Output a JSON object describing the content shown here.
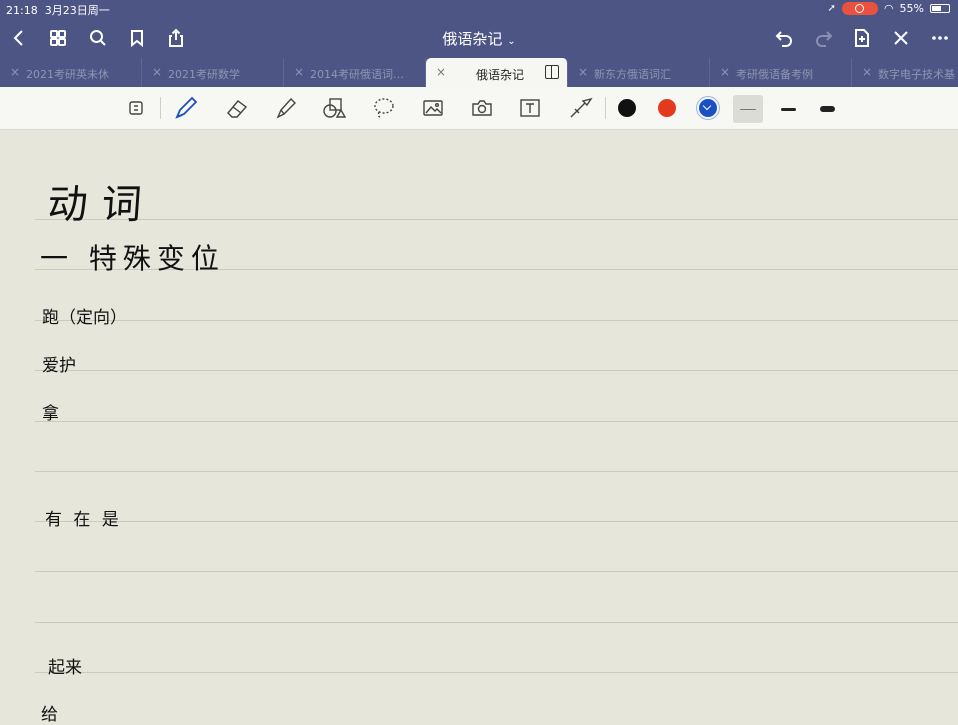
{
  "status": {
    "time": "21:18",
    "date": "3月23日周一",
    "battery": "55%",
    "battery_level": 0.55
  },
  "nav": {
    "title": "俄语杂记"
  },
  "tabs": [
    {
      "label": "2021考研英未休",
      "active": false
    },
    {
      "label": "2021考研数学",
      "active": false
    },
    {
      "label": "2014考研俄语词…",
      "active": false
    },
    {
      "label": "俄语杂记",
      "active": true
    },
    {
      "label": "新东方俄语词汇",
      "active": false
    },
    {
      "label": "考研俄语备考例",
      "active": false
    },
    {
      "label": "数字电子技术基",
      "active": false
    }
  ],
  "toolbar": {
    "colors": [
      "#111111",
      "#e2391f",
      "#1d4fc4"
    ],
    "selected_color_index": 2,
    "selected_stroke_index": 0
  },
  "notes": {
    "heading": "动词",
    "subheading": "一 特殊变位",
    "lines": [
      "跑（定向）",
      "爱护",
      "拿",
      "有 在 是",
      "起来",
      "给"
    ]
  }
}
